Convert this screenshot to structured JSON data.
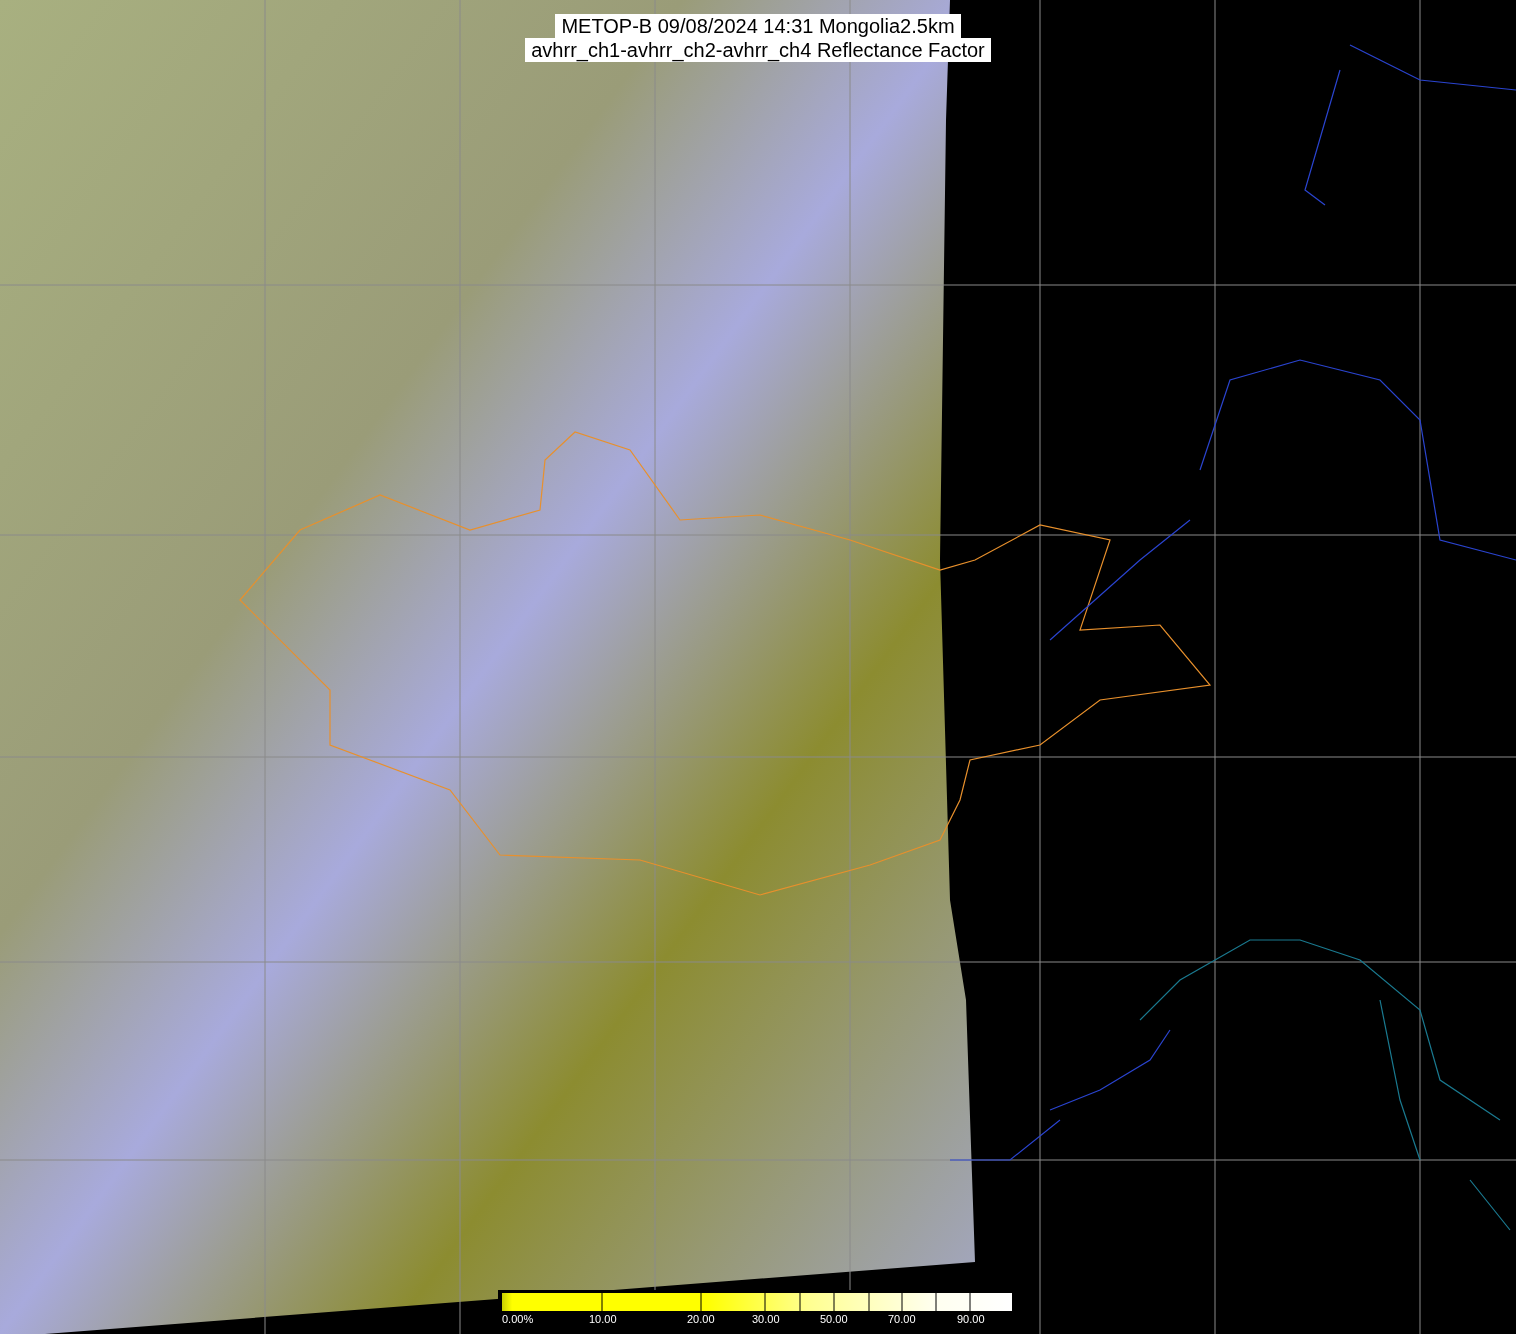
{
  "title": {
    "lines": [
      "METOP-B 09/08/2024 14:31 Mongolia2.5km",
      "avhrr_ch1-avhrr_ch2-avhrr_ch4 Reflectance Factor"
    ]
  },
  "colorbar": {
    "labels": [
      "0.00%",
      "10.00",
      "20.00",
      "30.00",
      "50.00",
      "70.00",
      "90.00"
    ]
  }
}
